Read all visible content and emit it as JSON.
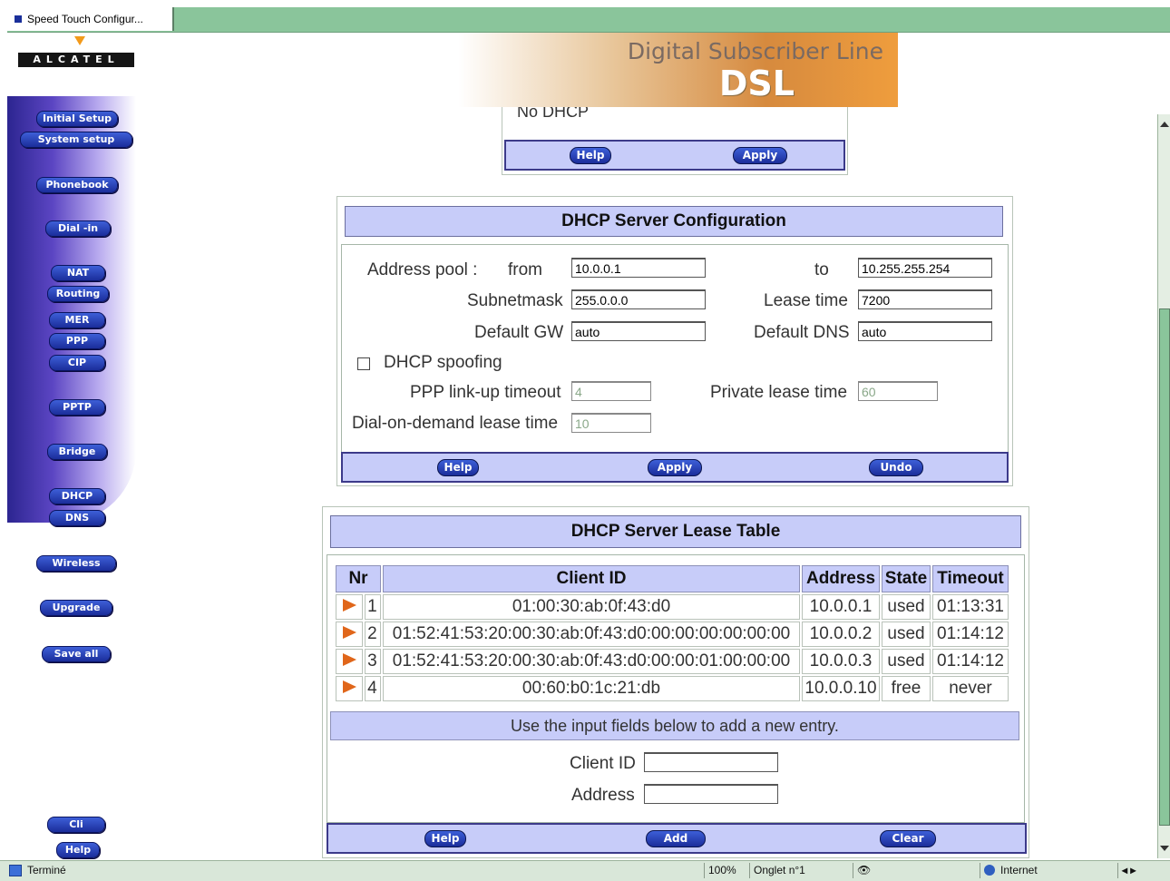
{
  "browser": {
    "tab_title": "Speed Touch Configur...",
    "status_text": "Terminé",
    "zoom": "100%",
    "tab_info": "Onglet n°1",
    "zone": "Internet"
  },
  "header": {
    "logo_text": "ALCATEL",
    "banner_title": "Digital Subscriber Line",
    "banner_sub": "DSL"
  },
  "sidebar": {
    "items": [
      {
        "label": "Initial Setup"
      },
      {
        "label": "System setup"
      },
      {
        "label": "Phonebook"
      },
      {
        "label": "Dial -in"
      },
      {
        "label": "NAT"
      },
      {
        "label": "Routing"
      },
      {
        "label": "MER"
      },
      {
        "label": "PPP"
      },
      {
        "label": "CIP"
      },
      {
        "label": "PPTP"
      },
      {
        "label": "Bridge"
      },
      {
        "label": "DHCP"
      },
      {
        "label": "DNS"
      },
      {
        "label": "Wireless"
      },
      {
        "label": "Upgrade"
      },
      {
        "label": "Save all"
      },
      {
        "label": "Cli"
      },
      {
        "label": "Help"
      }
    ]
  },
  "top_panel": {
    "partial_option": "No DHCP",
    "help": "Help",
    "apply": "Apply"
  },
  "server_config": {
    "title": "DHCP Server Configuration",
    "address_pool_label": "Address pool :",
    "from_label": "from",
    "from_value": "10.0.0.1",
    "to_label": "to",
    "to_value": "10.255.255.254",
    "subnetmask_label": "Subnetmask",
    "subnetmask_value": "255.0.0.0",
    "lease_time_label": "Lease time",
    "lease_time_value": "7200",
    "default_gw_label": "Default GW",
    "default_gw_value": "auto",
    "default_dns_label": "Default DNS",
    "default_dns_value": "auto",
    "spoofing_label": "DHCP spoofing",
    "spoofing_checked": false,
    "ppp_timeout_label": "PPP link-up timeout",
    "ppp_timeout_value": "4",
    "private_lease_label": "Private lease time",
    "private_lease_value": "60",
    "dod_label": "Dial-on-demand lease time",
    "dod_value": "10",
    "help": "Help",
    "apply": "Apply",
    "undo": "Undo"
  },
  "lease_table": {
    "title": "DHCP Server Lease Table",
    "columns": [
      "Nr",
      "Client ID",
      "Address",
      "State",
      "Timeout"
    ],
    "rows": [
      {
        "nr": "1",
        "client_id": "01:00:30:ab:0f:43:d0",
        "address": "10.0.0.1",
        "state": "used",
        "timeout": "01:13:31"
      },
      {
        "nr": "2",
        "client_id": "01:52:41:53:20:00:30:ab:0f:43:d0:00:00:00:00:00:00",
        "address": "10.0.0.2",
        "state": "used",
        "timeout": "01:14:12"
      },
      {
        "nr": "3",
        "client_id": "01:52:41:53:20:00:30:ab:0f:43:d0:00:00:01:00:00:00",
        "address": "10.0.0.3",
        "state": "used",
        "timeout": "01:14:12"
      },
      {
        "nr": "4",
        "client_id": "00:60:b0:1c:21:db",
        "address": "10.0.0.10",
        "state": "free",
        "timeout": "never"
      }
    ],
    "add_note": "Use the input fields below to add a new entry.",
    "client_id_label": "Client ID",
    "client_id_value": "",
    "address_label": "Address",
    "address_value": "",
    "help": "Help",
    "add": "Add",
    "clear": "Clear"
  }
}
